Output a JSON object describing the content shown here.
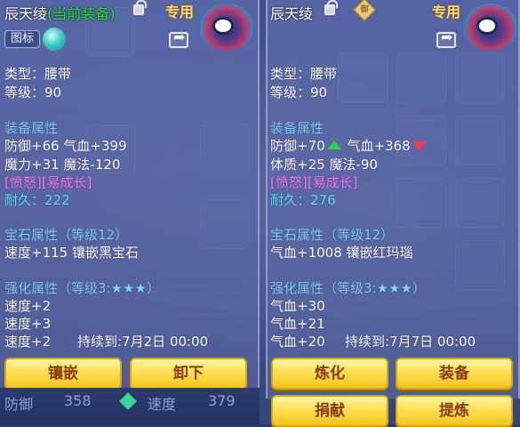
{
  "left": {
    "title": "辰天绫",
    "title_current": "(当前装备)",
    "zhuanyong": "专用",
    "icon_toggle": "图标",
    "type_line": "类型：腰带",
    "level_line": "等级：90",
    "equip_attr_header": "装备属性",
    "attr1": "防御+66 气血+399",
    "attr2": "魔力+31 魔法-120",
    "special": "[愤怒][易成长]",
    "durability": "耐久：222",
    "gem_header": "宝石属性（等级12）",
    "gem_line": "速度+115 镶嵌黑宝石",
    "enhance_header": "强化属性（等级3:★★★）",
    "enh1": "速度+2",
    "enh2": "速度+3",
    "enh3": "速度+2",
    "duration": "持续到:7月2日 00:00",
    "btn_inlay": "镶嵌",
    "btn_unequip": "卸下",
    "bottom_def": "防御",
    "bottom_def_val": "358",
    "bottom_speed": "速度",
    "bottom_speed_val": "379"
  },
  "right": {
    "title": "辰天绫",
    "seal": "御",
    "zhuanyong": "专用",
    "type_line": "类型：腰带",
    "level_line": "等级：90",
    "equip_attr_header": "装备属性",
    "attr1_a": "防御+70",
    "attr1_b": "气血+368",
    "attr2": "体质+25 魔法-90",
    "special": "[愤怒][易成长]",
    "durability": "耐久：276",
    "gem_header": "宝石属性（等级12）",
    "gem_line": "气血+1008 镶嵌红玛瑙",
    "enhance_header": "强化属性（等级3:★★★）",
    "enh1": "气血+30",
    "enh2": "气血+21",
    "enh3": "气血+20",
    "duration": "持续到:7月7日 00:00",
    "btn_refine": "炼化",
    "btn_equip": "装备",
    "btn_donate": "捐献",
    "btn_extract": "提炼"
  }
}
